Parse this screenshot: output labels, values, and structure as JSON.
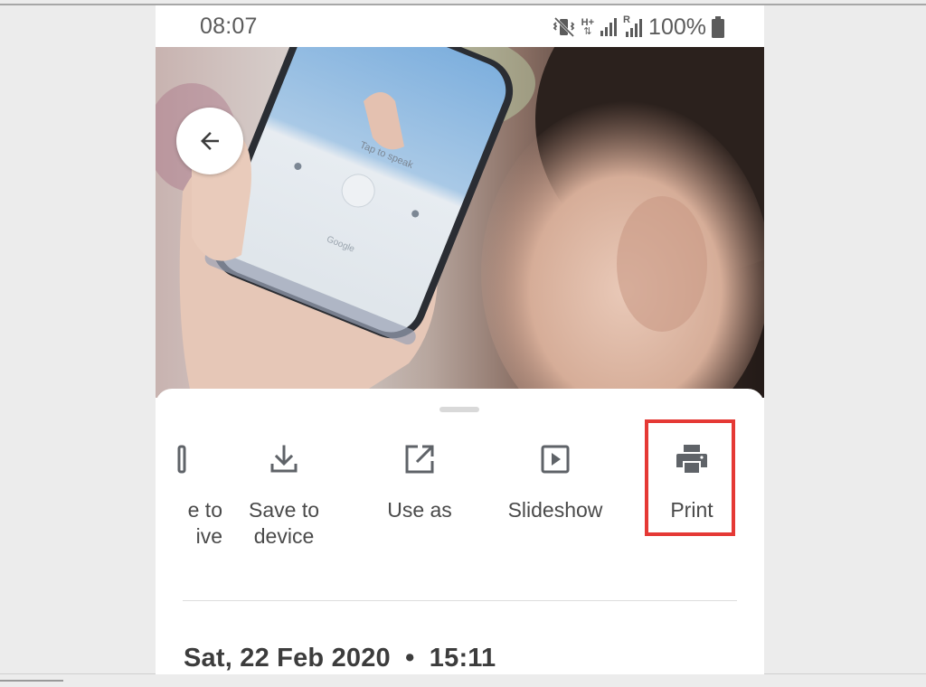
{
  "status_bar": {
    "time": "08:07",
    "battery_percent": "100%",
    "network_label": "H+",
    "roaming_label": "R",
    "icons": [
      "vibrate-mute-icon",
      "data-arrows-icon",
      "signal-icon",
      "signal-roaming-icon",
      "battery-full-icon"
    ]
  },
  "photo": {
    "phone_screen_text": "Tap to speak",
    "phone_brand_text": "Google"
  },
  "back_button": {
    "icon": "arrow-back-icon"
  },
  "share_actions": [
    {
      "label_line1": "e to",
      "label_line2": "ive",
      "icon": "drive-icon"
    },
    {
      "label_line1": "Save to",
      "label_line2": "device",
      "icon": "download-icon"
    },
    {
      "label_line1": "Use as",
      "label_line2": "",
      "icon": "open-external-icon"
    },
    {
      "label_line1": "Slideshow",
      "label_line2": "",
      "icon": "slideshow-play-icon"
    },
    {
      "label_line1": "Print",
      "label_line2": "",
      "icon": "printer-icon"
    }
  ],
  "highlight": {
    "target": "Print",
    "color": "#e53935"
  },
  "details": {
    "date": "Sat, 22 Feb 2020",
    "separator": "•",
    "time": "15:11"
  },
  "colors": {
    "icon_gray": "#5f6368",
    "text_gray": "#4a4a4a",
    "highlight_red": "#e53935"
  }
}
